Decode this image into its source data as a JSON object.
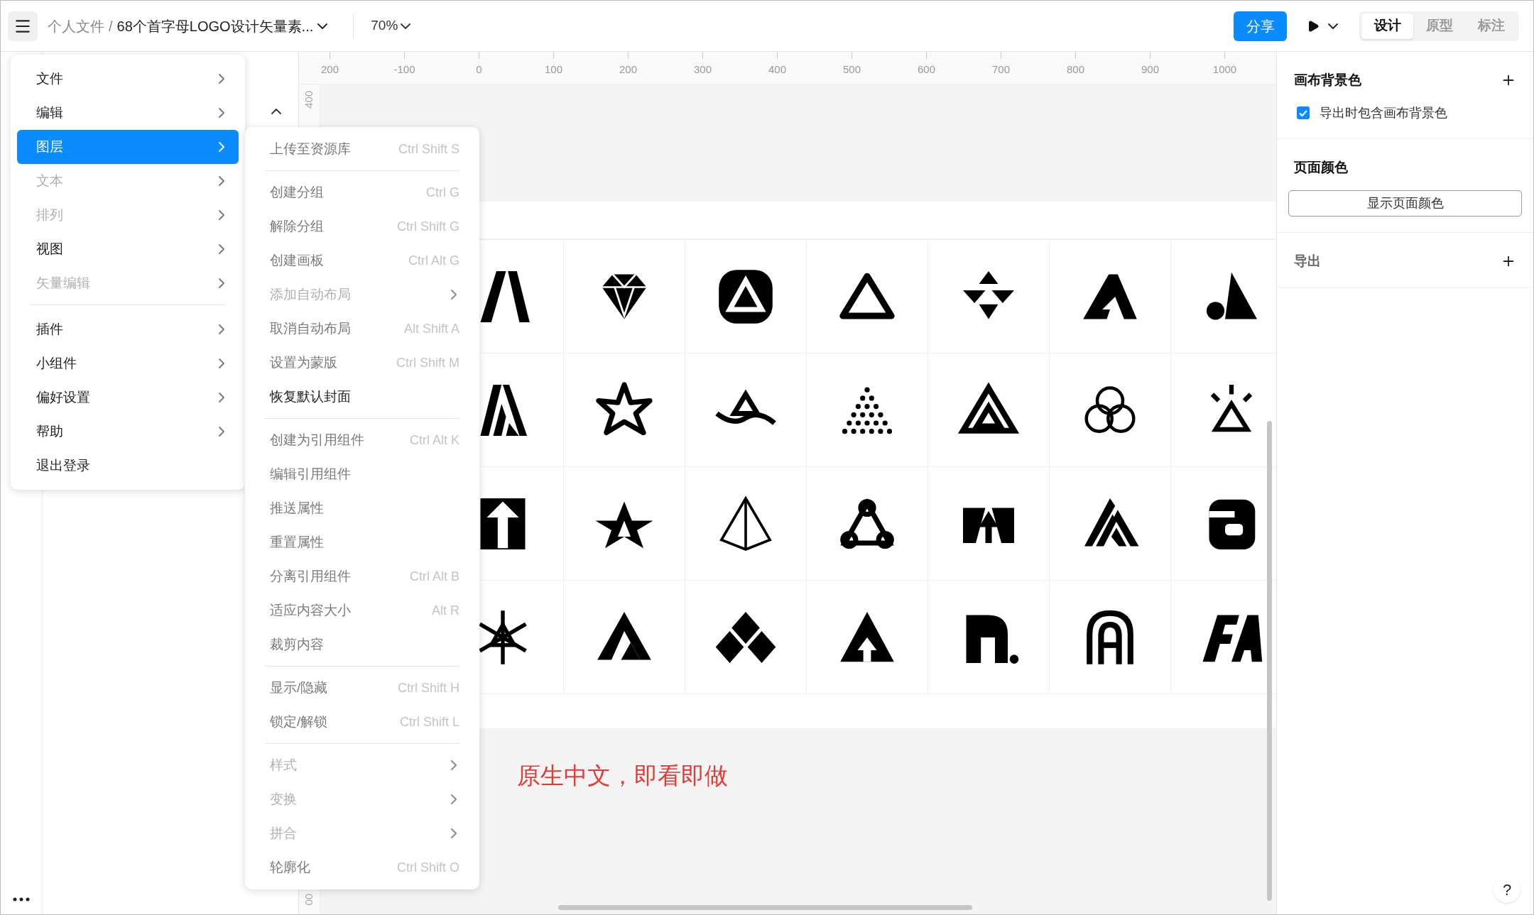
{
  "topbar": {
    "breadcrumb_parent": "个人文件",
    "separator": "/",
    "title": "68个首字母LOGO设计矢量素...",
    "zoom": "70%",
    "share": "分享",
    "modes": [
      {
        "label": "设计",
        "selected": true
      },
      {
        "label": "原型",
        "selected": false
      },
      {
        "label": "标注",
        "selected": false
      }
    ]
  },
  "main_menu": {
    "groups": [
      [
        {
          "label": "文件",
          "disabled": false,
          "selected": false,
          "has_submenu": true
        },
        {
          "label": "编辑",
          "disabled": false,
          "selected": false,
          "has_submenu": true
        },
        {
          "label": "图层",
          "disabled": false,
          "selected": true,
          "has_submenu": true
        },
        {
          "label": "文本",
          "disabled": true,
          "selected": false,
          "has_submenu": true
        },
        {
          "label": "排列",
          "disabled": true,
          "selected": false,
          "has_submenu": true
        },
        {
          "label": "视图",
          "disabled": false,
          "selected": false,
          "has_submenu": true
        },
        {
          "label": "矢量编辑",
          "disabled": true,
          "selected": false,
          "has_submenu": true
        }
      ],
      [
        {
          "label": "插件",
          "disabled": false,
          "selected": false,
          "has_submenu": true
        },
        {
          "label": "小组件",
          "disabled": false,
          "selected": false,
          "has_submenu": true
        },
        {
          "label": "偏好设置",
          "disabled": false,
          "selected": false,
          "has_submenu": true
        },
        {
          "label": "帮助",
          "disabled": false,
          "selected": false,
          "has_submenu": true
        },
        {
          "label": "退出登录",
          "disabled": false,
          "selected": false,
          "has_submenu": false
        }
      ]
    ]
  },
  "layer_submenu": {
    "groups": [
      [
        {
          "label": "上传至资源库",
          "shortcut": "Ctrl Shift S",
          "disabled": false,
          "active": false,
          "has_submenu": false
        }
      ],
      [
        {
          "label": "创建分组",
          "shortcut": "Ctrl G",
          "disabled": false,
          "active": false,
          "has_submenu": false
        },
        {
          "label": "解除分组",
          "shortcut": "Ctrl Shift G",
          "disabled": false,
          "active": false,
          "has_submenu": false
        },
        {
          "label": "创建画板",
          "shortcut": "Ctrl Alt G",
          "disabled": false,
          "active": false,
          "has_submenu": false
        },
        {
          "label": "添加自动布局",
          "disabled": true,
          "active": false,
          "has_submenu": true
        },
        {
          "label": "取消自动布局",
          "shortcut": "Alt Shift A",
          "disabled": false,
          "active": false,
          "has_submenu": false
        },
        {
          "label": "设置为蒙版",
          "shortcut": "Ctrl Shift M",
          "disabled": false,
          "active": false,
          "has_submenu": false
        },
        {
          "label": "恢复默认封面",
          "disabled": false,
          "active": true,
          "has_submenu": false
        }
      ],
      [
        {
          "label": "创建为引用组件",
          "shortcut": "Ctrl Alt K",
          "disabled": false,
          "active": false,
          "has_submenu": false
        },
        {
          "label": "编辑引用组件",
          "disabled": false,
          "active": false,
          "has_submenu": false
        },
        {
          "label": "推送属性",
          "disabled": false,
          "active": false,
          "has_submenu": false
        },
        {
          "label": "重置属性",
          "disabled": false,
          "active": false,
          "has_submenu": false
        },
        {
          "label": "分离引用组件",
          "shortcut": "Ctrl Alt B",
          "disabled": false,
          "active": false,
          "has_submenu": false
        },
        {
          "label": "适应内容大小",
          "shortcut": "Alt R",
          "disabled": false,
          "active": false,
          "has_submenu": false
        },
        {
          "label": "裁剪内容",
          "disabled": false,
          "active": false,
          "has_submenu": false
        }
      ],
      [
        {
          "label": "显示/隐藏",
          "shortcut": "Ctrl Shift H",
          "disabled": false,
          "active": false,
          "has_submenu": false
        },
        {
          "label": "锁定/解锁",
          "shortcut": "Ctrl Shift L",
          "disabled": false,
          "active": false,
          "has_submenu": false
        }
      ],
      [
        {
          "label": "样式",
          "disabled": true,
          "active": false,
          "has_submenu": true
        },
        {
          "label": "变换",
          "disabled": true,
          "active": false,
          "has_submenu": true
        },
        {
          "label": "拼合",
          "disabled": true,
          "active": false,
          "has_submenu": true
        },
        {
          "label": "轮廓化",
          "shortcut": "Ctrl Shift O",
          "disabled": false,
          "active": false,
          "has_submenu": false
        }
      ]
    ]
  },
  "ruler": {
    "x_labels": [
      "200",
      "-100",
      "0",
      "100",
      "200",
      "300",
      "400",
      "500",
      "600",
      "700",
      "800",
      "900",
      "1000"
    ],
    "y_labels": [
      "400",
      "00"
    ]
  },
  "canvas": {
    "caption": "原生中文，即看即做"
  },
  "right_panel": {
    "sections": [
      {
        "title": "画布背景色",
        "muted": false,
        "addable": true,
        "checkbox": {
          "label": "导出时包含画布背景色",
          "checked": true
        }
      },
      {
        "title": "页面颜色",
        "muted": false,
        "button": "显示页面颜色"
      },
      {
        "title": "导出",
        "muted": true,
        "addable": true
      }
    ]
  },
  "help": "?"
}
